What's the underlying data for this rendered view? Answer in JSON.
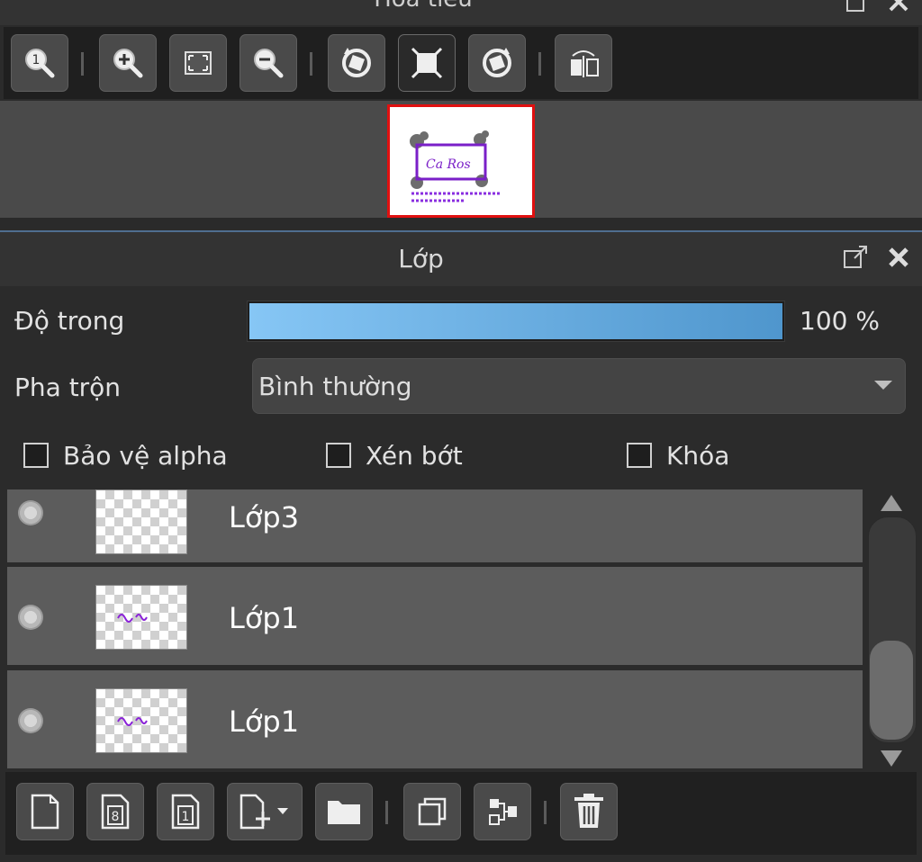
{
  "navigator": {
    "title": "Hoa tiêu",
    "toolbar": [
      {
        "name": "zoom-actual-icon"
      },
      {
        "name": "zoom-in-icon"
      },
      {
        "name": "fit-screen-icon"
      },
      {
        "name": "zoom-out-icon"
      },
      {
        "name": "rotate-left-icon"
      },
      {
        "name": "fit-canvas-icon"
      },
      {
        "name": "rotate-right-icon"
      },
      {
        "name": "flip-horizontal-icon"
      }
    ]
  },
  "layer_panel": {
    "title": "Lớp",
    "opacity": {
      "label": "Độ trong",
      "value": 100,
      "display": "100 %"
    },
    "blend": {
      "label": "Pha trộn",
      "selected": "Bình thường"
    },
    "checkboxes": [
      {
        "label": "Bảo vệ alpha",
        "checked": false
      },
      {
        "label": "Xén bớt",
        "checked": false
      },
      {
        "label": "Khóa",
        "checked": false
      }
    ],
    "layers": [
      {
        "name": "Lớp3",
        "thumbnail": "empty"
      },
      {
        "name": "Lớp1",
        "thumbnail": "text"
      },
      {
        "name": "Lớp1",
        "thumbnail": "text"
      }
    ],
    "bottom_toolbar": [
      {
        "name": "new-layer-icon"
      },
      {
        "name": "new-8bit-layer-icon"
      },
      {
        "name": "new-1bit-layer-icon"
      },
      {
        "name": "add-layer-dropdown-icon"
      },
      {
        "name": "new-folder-icon"
      },
      {
        "name": "duplicate-layer-icon"
      },
      {
        "name": "merge-down-icon"
      },
      {
        "name": "delete-layer-icon"
      }
    ]
  },
  "colors": {
    "accent_blue": "#5ea9e0",
    "preview_border": "#e01010",
    "panel_bg": "#2b2b2b",
    "row_bg": "#5c5c5c"
  }
}
